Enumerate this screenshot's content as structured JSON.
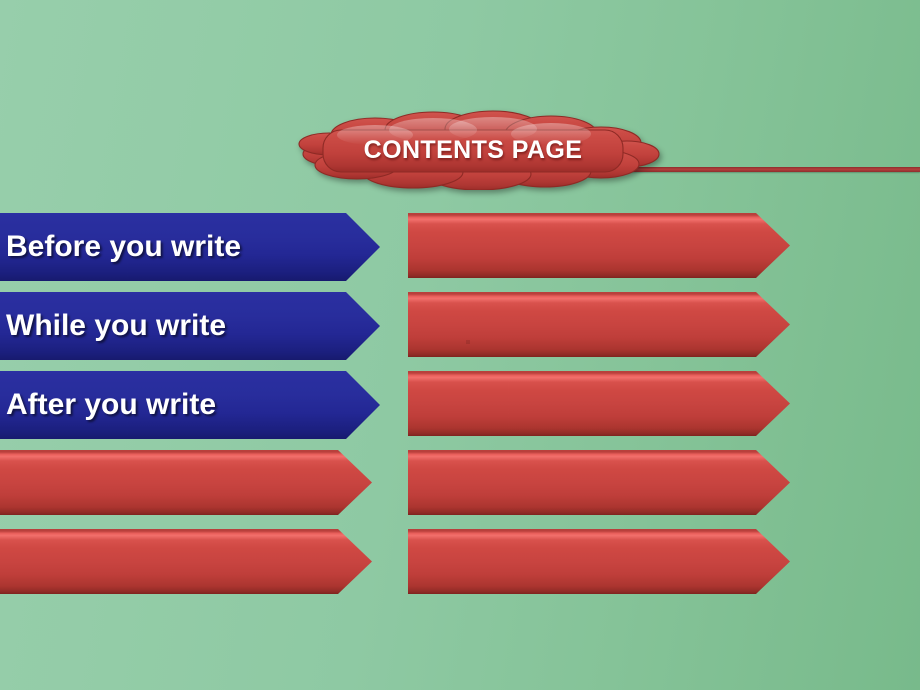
{
  "slide": {
    "title": "CONTENTS PAGE",
    "background_color_left": "#97ceab",
    "background_color_right": "#78ba8b",
    "accent_rule_color": "#b4403c"
  },
  "title_callout": {
    "label": "CONTENTS PAGE",
    "shape": "cloud-callout",
    "fill_color": "#c1413c",
    "text_color": "#ffffff"
  },
  "left_column": {
    "banners": [
      {
        "label": "Before you write",
        "color": "#282d9c",
        "style": "blue",
        "filled": true
      },
      {
        "label": "While you write",
        "color": "#282d9c",
        "style": "blue",
        "filled": true
      },
      {
        "label": "After you write",
        "color": "#282d9c",
        "style": "blue",
        "filled": true
      },
      {
        "label": "",
        "color": "#c84440",
        "style": "red",
        "filled": false
      },
      {
        "label": "",
        "color": "#c84440",
        "style": "red",
        "filled": false
      }
    ]
  },
  "right_column": {
    "banners": [
      {
        "label": "",
        "color": "#c84440",
        "style": "red",
        "filled": false
      },
      {
        "label": "",
        "color": "#c84440",
        "style": "red",
        "filled": false
      },
      {
        "label": "",
        "color": "#c84440",
        "style": "red",
        "filled": false
      },
      {
        "label": "",
        "color": "#c84440",
        "style": "red",
        "filled": false
      },
      {
        "label": "",
        "color": "#c84440",
        "style": "red",
        "filled": false
      }
    ]
  }
}
